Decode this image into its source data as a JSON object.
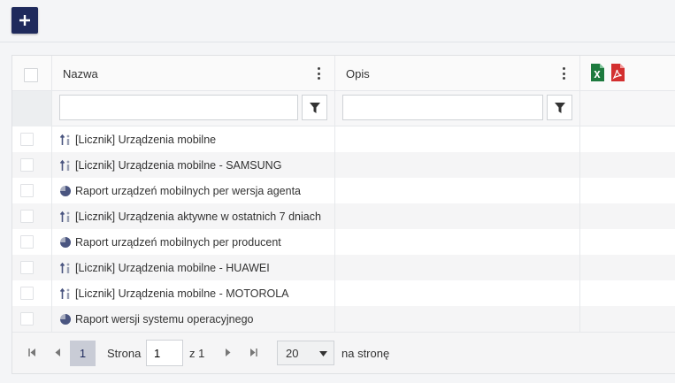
{
  "toolbar": {
    "add_icon": "plus-icon"
  },
  "grid": {
    "columns": [
      {
        "label": "Nazwa"
      },
      {
        "label": "Opis"
      }
    ],
    "export": {
      "excel_icon": "excel-icon",
      "pdf_icon": "pdf-icon"
    },
    "filters": {
      "name_value": "",
      "desc_value": ""
    },
    "rows": [
      {
        "icon": "counter-icon",
        "name": "[Licznik] Urządzenia mobilne",
        "desc": ""
      },
      {
        "icon": "counter-icon",
        "name": "[Licznik] Urządzenia mobilne - SAMSUNG",
        "desc": ""
      },
      {
        "icon": "pie-chart-icon",
        "name": "Raport urządzeń mobilnych per wersja agenta",
        "desc": ""
      },
      {
        "icon": "counter-icon",
        "name": "[Licznik] Urządzenia aktywne w ostatnich 7 dniach",
        "desc": ""
      },
      {
        "icon": "pie-chart-icon",
        "name": "Raport urządzeń mobilnych per producent",
        "desc": ""
      },
      {
        "icon": "counter-icon",
        "name": "[Licznik] Urządzenia mobilne - HUAWEI",
        "desc": ""
      },
      {
        "icon": "counter-icon",
        "name": "[Licznik] Urządzenia mobilne - MOTOROLA",
        "desc": ""
      },
      {
        "icon": "pie-chart-icon",
        "name": "Raport wersji systemu operacyjnego",
        "desc": ""
      }
    ]
  },
  "pager": {
    "current_page": "1",
    "page_label": "Strona",
    "page_input": "1",
    "of_label": "z 1",
    "page_size": "20",
    "per_page_label": "na stronę"
  },
  "colors": {
    "accent": "#1f2a5c",
    "excel": "#1d7a3e",
    "pdf": "#d32f2f"
  }
}
